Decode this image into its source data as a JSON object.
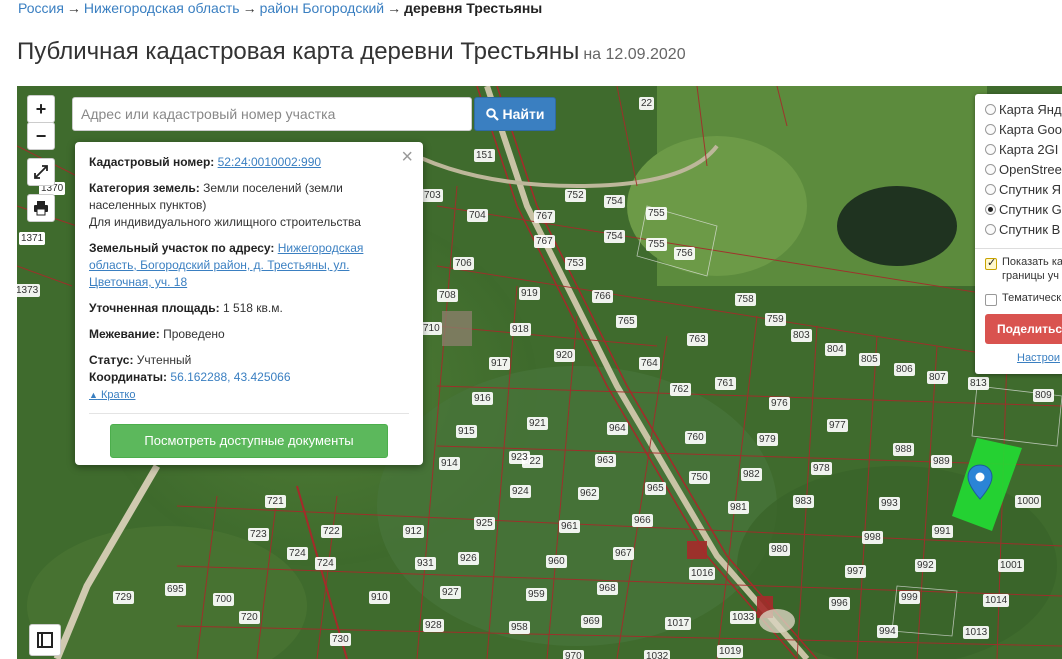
{
  "breadcrumb": {
    "items": [
      "Россия",
      "Нижегородская область",
      "район Богородский"
    ],
    "current": "деревня Трестьяны",
    "separator": "→"
  },
  "title": {
    "text": "Публичная кадастровая карта деревни Трестьяны",
    "date": "на 12.09.2020"
  },
  "map_controls": {
    "zoom_in": "+",
    "zoom_out": "−",
    "fullscreen_icon": "expand-icon",
    "print_icon": "printer-icon",
    "legend_icon": "book-icon"
  },
  "search": {
    "placeholder": "Адрес или кадастровый номер участка",
    "button_label": "Найти",
    "button_icon": "search-icon"
  },
  "popup": {
    "close": "×",
    "cad_label": "Кадастровый номер:",
    "cad_value": "52:24:0010002:990",
    "category_label": "Категория земель:",
    "category_value": "Земли поселений (земли населенных пунктов)",
    "usage": "Для индивидуального жилищного строительства",
    "address_label": "Земельный участок по адресу:",
    "address_value": "Нижегородская область, Богородский район, д. Трестьяны, ул. Цветочная, уч. 18",
    "area_label": "Уточненная площадь:",
    "area_value": "1 518 кв.м.",
    "survey_label": "Межевание:",
    "survey_value": "Проведено",
    "status_label": "Статус:",
    "status_value": "Учтенный",
    "coords_label": "Координаты:",
    "coords_value": "56.162288, 43.425066",
    "short_link": "Кратко",
    "docs_button": "Посмотреть доступные документы"
  },
  "layers": {
    "options": [
      {
        "label": "Карта Янд",
        "selected": false
      },
      {
        "label": "Карта Goo",
        "selected": false
      },
      {
        "label": "Карта 2GI",
        "selected": false
      },
      {
        "label": "OpenStree",
        "selected": false
      },
      {
        "label": "Спутник Я",
        "selected": false
      },
      {
        "label": "Спутник G",
        "selected": true
      },
      {
        "label": "Спутник B",
        "selected": false
      }
    ],
    "show_borders_line1": "Показать ка",
    "show_borders_line2": "границы уч",
    "show_borders_checked": true,
    "thematic": "Тематическ",
    "thematic_checked": false,
    "share_button": "Поделитьс",
    "settings_link": "Настрои"
  },
  "parcel_labels": [
    "22",
    "151",
    "703",
    "704",
    "767",
    "752",
    "754",
    "755",
    "767",
    "754",
    "755",
    "756",
    "753",
    "706",
    "708",
    "710",
    "919",
    "918",
    "766",
    "765",
    "758",
    "759",
    "803",
    "804",
    "805",
    "806",
    "807",
    "813",
    "809",
    "917",
    "920",
    "764",
    "763",
    "762",
    "761",
    "916",
    "921",
    "915",
    "922",
    "964",
    "760",
    "976",
    "977",
    "979",
    "988",
    "989",
    "914",
    "923",
    "963",
    "965",
    "750",
    "982",
    "978",
    "1000",
    "721",
    "924",
    "962",
    "981",
    "983",
    "993",
    "723",
    "722",
    "912",
    "925",
    "961",
    "966",
    "998",
    "991",
    "724",
    "724",
    "931",
    "926",
    "960",
    "967",
    "1016",
    "980",
    "997",
    "992",
    "1001",
    "729",
    "695",
    "700",
    "910",
    "927",
    "959",
    "968",
    "996",
    "999",
    "1014",
    "720",
    "730",
    "928",
    "958",
    "969",
    "1017",
    "1033",
    "994",
    "1013",
    "970",
    "1032",
    "1019",
    "1370",
    "1371",
    "1373",
    "1370",
    "1371"
  ],
  "colors": {
    "parcel_border": "#a52a2a",
    "selected_parcel": "#22dd33",
    "link": "#3a7fc1",
    "docs_button": "#5cb85c",
    "share_button": "#d9534f",
    "pin": "#2b84d6"
  }
}
